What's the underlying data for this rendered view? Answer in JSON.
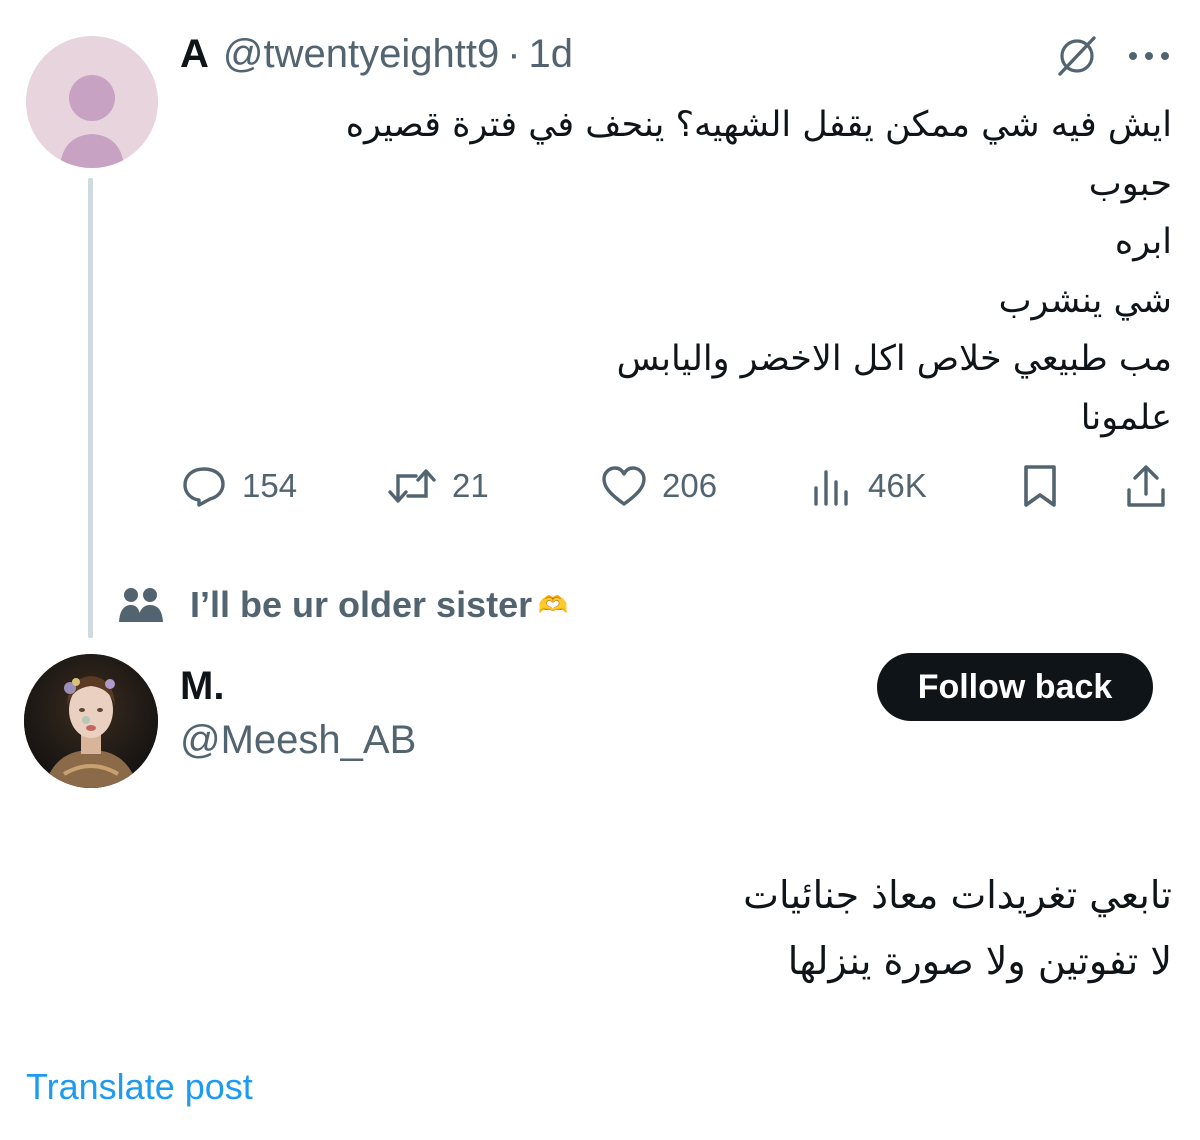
{
  "tweet1": {
    "author_name": "A",
    "handle": "@twentyeightt9",
    "separator": "·",
    "time": "1d",
    "avatar_icon": "default-avatar-icon",
    "lines": [
      "ايش فيه شي ممكن يقفل الشهيه؟ ينحف في فترة قصيره",
      "حبوب",
      "ابره",
      "شي ينشرب",
      "مب طبيعي خلاص اكل الاخضر واليابس",
      "علمونا"
    ],
    "stats": {
      "replies": "154",
      "reposts": "21",
      "likes": "206",
      "views": "46K"
    },
    "icons": [
      "grok-icon",
      "more-icon",
      "reply-icon",
      "repost-icon",
      "like-icon",
      "views-icon",
      "bookmark-icon",
      "share-icon"
    ]
  },
  "social_context": {
    "text": "I’ll be ur older sister",
    "emoji": "🫶",
    "icon": "people-icon"
  },
  "tweet2": {
    "author_name": "M.",
    "handle": "@Meesh_AB",
    "follow_label": "Follow back",
    "lines": [
      "تابعي تغريدات معاذ جنائيات",
      "لا تفوتين ولا صورة ينزلها"
    ],
    "translate_label": "Translate post"
  },
  "colors": {
    "primary_text": "#0f1419",
    "secondary_text": "#536471",
    "link": "#1d9bf0",
    "button_bg": "#0f1419",
    "thread_line": "#cfd9de"
  }
}
